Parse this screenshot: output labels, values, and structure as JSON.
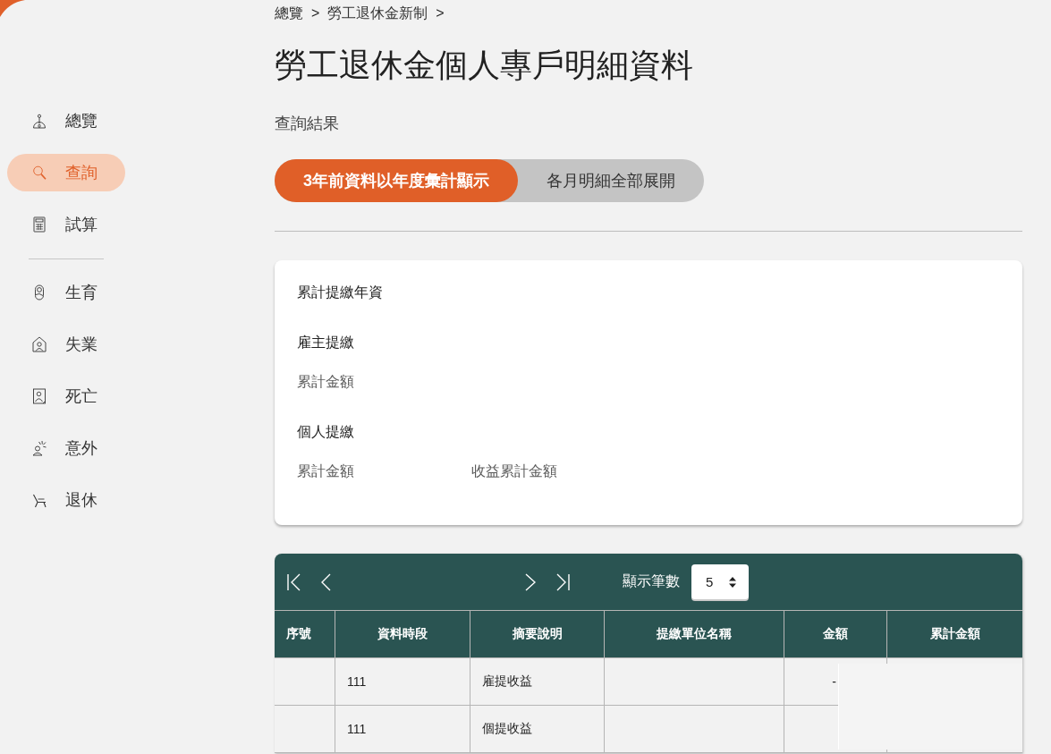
{
  "sidebar": {
    "sections": [
      {
        "items": [
          {
            "label": "總覽",
            "selected": false
          },
          {
            "label": "查詢",
            "selected": true
          },
          {
            "label": "試算",
            "selected": false
          }
        ]
      },
      {
        "items": [
          {
            "label": "生育",
            "selected": false
          },
          {
            "label": "失業",
            "selected": false
          },
          {
            "label": "死亡",
            "selected": false
          },
          {
            "label": "意外",
            "selected": false
          },
          {
            "label": "退休",
            "selected": false
          }
        ]
      }
    ]
  },
  "breadcrumb": [
    {
      "label": "總覽",
      "separator": ">"
    },
    {
      "label": "勞工退休金新制",
      "separator": ">"
    }
  ],
  "page_title": "勞工退休金個人專戶明細資料",
  "result_label": "查詢結果",
  "view_toggle": [
    {
      "label": "3年前資料以年度彙計顯示",
      "selected": true
    },
    {
      "label": "各月明細全部展開",
      "selected": false
    }
  ],
  "summary": [
    {
      "kind": "heading",
      "labels": [
        "累計提繳年資"
      ]
    },
    {
      "kind": "heading",
      "labels": [
        "雇主提繳"
      ]
    },
    {
      "kind": "fields",
      "labels": [
        "累計金額"
      ]
    },
    {
      "kind": "heading",
      "labels": [
        "個人提繳"
      ]
    },
    {
      "kind": "fields",
      "labels": [
        "累計金額",
        "收益累計金額"
      ]
    }
  ],
  "table": {
    "pager": {
      "page_size_label": "顯示筆數",
      "page_size": "5"
    },
    "columns": [
      "序號",
      "資料時段",
      "摘要說明",
      "提繳單位名稱",
      "金額",
      "累計金額"
    ],
    "rows": [
      {
        "period": "111",
        "description": "雇提收益",
        "amount": "-"
      },
      {
        "period": "111",
        "description": "個提收益"
      }
    ]
  }
}
